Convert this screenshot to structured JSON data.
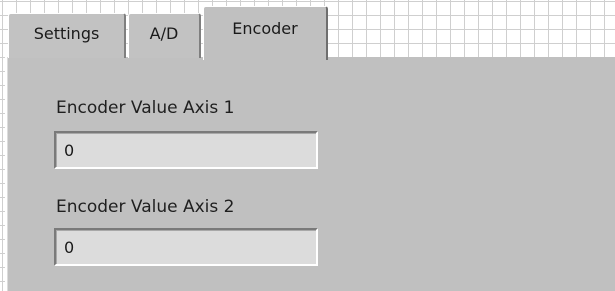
{
  "tabs": [
    {
      "label": "Settings",
      "selected": false
    },
    {
      "label": "A/D",
      "selected": false
    },
    {
      "label": "Encoder",
      "selected": true
    }
  ],
  "encoder_panel": {
    "axis1": {
      "label": "Encoder Value Axis 1",
      "value": "0"
    },
    "axis2": {
      "label": "Encoder Value Axis 2",
      "value": "0"
    }
  },
  "colors": {
    "panel_background": "#c0c0c0",
    "indicator_background": "#dcdcdc",
    "grid_lines": "#cfcfcf"
  }
}
